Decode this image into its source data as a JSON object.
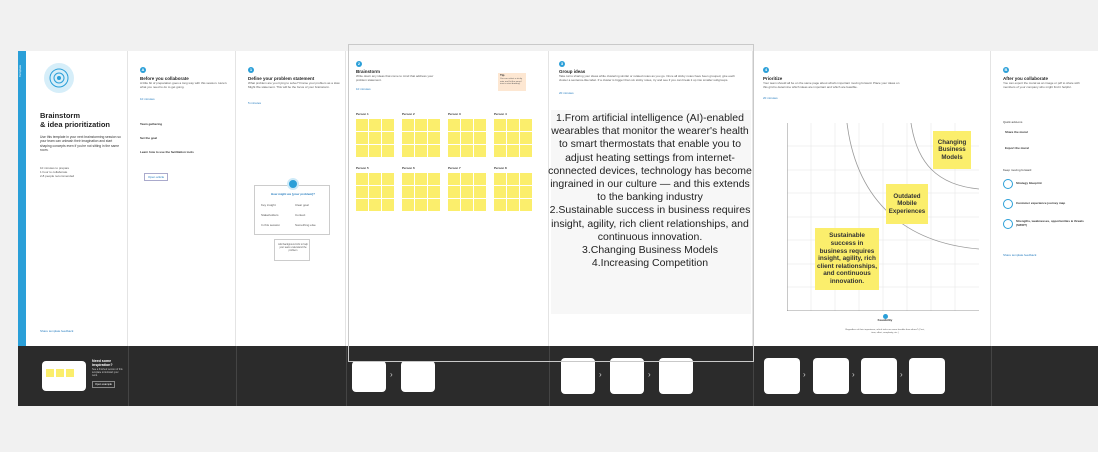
{
  "template": {
    "sidebar_label": "Template",
    "title_line1": "Brainstorm",
    "title_line2": "& idea prioritization",
    "description": "Use this template in your next brainstorming session so your team can unleash their imagination and start shaping concepts even if you're not sitting in the same room.",
    "bullets": [
      "10 minutes to prepare",
      "1 hour to collaborate",
      "2-8 people recommended"
    ],
    "footer_link": "Share template feedback"
  },
  "panels": {
    "before": {
      "number": "A",
      "title": "Before you collaborate",
      "text": "A little bit of preparation goes a long way with this session. Here's what you need to do to get going.",
      "link": "10 minutes",
      "steps": [
        "Team gathering",
        "Set the goal",
        "Learn how to use the facilitation tools"
      ],
      "button": "Open article"
    },
    "define": {
      "number": "1",
      "title": "Define your problem statement",
      "text": "What problem are you trying to solve? Frame your problem as a How Might We statement. This will be the focus of your brainstorm.",
      "link": "5 minutes",
      "card_title": "How might we [your problem]?",
      "card_items": [
        "Key insight",
        "Clear goal",
        "Stakeholders",
        "Context",
        "In this session",
        "Something else"
      ],
      "card2_text": "Add background info to help your team understand the problem"
    },
    "brainstorm": {
      "number": "2",
      "title": "Brainstorm",
      "text": "Write down any ideas that come to mind that address your problem statement.",
      "link": "10 minutes",
      "tip_title": "Tip",
      "tip_text": "You can select a sticky note and hit the pencil icon to start drawing!",
      "people": [
        "Person 1",
        "Person 2",
        "Person 3",
        "Person 4",
        "Person 5",
        "Person 6",
        "Person 7",
        "Person 8"
      ]
    },
    "group": {
      "number": "3",
      "title": "Group ideas",
      "text": "Take turns sharing your ideas while clustering similar or related notes as you go. Once all sticky notes have been grouped, give each cluster a sentence-like label. If a cluster is bigger than six sticky notes, try and see if you can break it up into smaller subgroups.",
      "link": "20 minutes"
    },
    "prioritize": {
      "number": "4",
      "title": "Prioritize",
      "text": "Your team should all be on the same page about what's important moving forward. Place your ideas on this grid to determine which ideas are important and which are feasible.",
      "link": "20 minutes",
      "x_axis": "Feasibility",
      "y_axis": "Importance",
      "x_caption": "Regardless of their importance, which tasks are more feasible than others? (Cost, time, effort, complexity, etc.)",
      "stickies": [
        "Changing Business Models",
        "Outdated Mobile Experiences",
        "Sustainable success in business requires insight, agility, rich client relationships, and continuous innovation."
      ]
    },
    "after": {
      "number": "B",
      "title": "After you collaborate",
      "text": "You can export the mural as an image or pdf to share with members of your company who might find it helpful.",
      "sub1": "Quick add-ons",
      "sub1_items": [
        "Share the mural",
        "Export the mural"
      ],
      "sub2": "Keep moving forward",
      "sub2_items": [
        "Strategy blueprint",
        "Customer experience journey map",
        "Strengths, weaknesses, opportunities & threats (SWOT)"
      ],
      "link": "Share template feedback"
    }
  },
  "overlay_text": {
    "line1": "1.From artificial intelligence (AI)-enabled wearables that monitor the wearer's health to smart thermostats that enable you to adjust heating settings from internet-connected devices, technology has become ingrained in our culture — and this extends to the banking industry",
    "line2": "2.Sustainable success in business requires insight, agility, rich client relationships, and continuous innovation.",
    "line3": "3.Changing Business Models",
    "line4": "4.Increasing Competition"
  },
  "thumb_strip": {
    "preview_title": "Need some inspiration?",
    "preview_text": "See a finished version of this template to kickstart your work.",
    "preview_button": "Open example"
  },
  "colors": {
    "accent": "#2a9fd8",
    "sticky": "#fbee6c",
    "strip": "#2b2b2b"
  }
}
